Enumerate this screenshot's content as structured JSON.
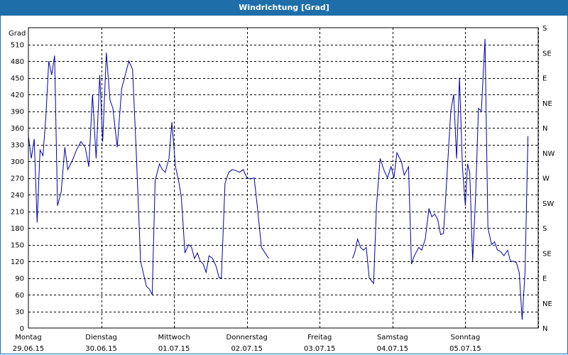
{
  "window": {
    "title": "Windrichtung [Grad]"
  },
  "chart_data": {
    "type": "line",
    "title": "Windrichtung [Grad]",
    "ylabel": "Grad",
    "ylim": [
      0,
      540
    ],
    "xlim": [
      0,
      7
    ],
    "y_ticks": [
      0,
      30,
      60,
      90,
      120,
      150,
      180,
      210,
      240,
      270,
      300,
      330,
      360,
      390,
      420,
      450,
      480,
      510
    ],
    "right_ticks": [
      {
        "v": 0,
        "label": "N"
      },
      {
        "v": 45,
        "label": "NE"
      },
      {
        "v": 90,
        "label": "E"
      },
      {
        "v": 135,
        "label": "SE"
      },
      {
        "v": 180,
        "label": "S"
      },
      {
        "v": 225,
        "label": "SW"
      },
      {
        "v": 270,
        "label": "W"
      },
      {
        "v": 315,
        "label": "NW"
      },
      {
        "v": 360,
        "label": "N"
      },
      {
        "v": 405,
        "label": "NE"
      },
      {
        "v": 450,
        "label": "E"
      },
      {
        "v": 495,
        "label": "SE"
      },
      {
        "v": 540,
        "label": "S"
      }
    ],
    "x_ticks": [
      {
        "day": "Montag",
        "date": "29.06.15"
      },
      {
        "day": "Dienstag",
        "date": "30.06.15"
      },
      {
        "day": "Mittwoch",
        "date": "01.07.15"
      },
      {
        "day": "Donnerstag",
        "date": "02.07.15"
      },
      {
        "day": "Freitag",
        "date": "03.07.15"
      },
      {
        "day": "Samstag",
        "date": "04.07.15"
      },
      {
        "day": "Sonntag",
        "date": "05.07.15"
      }
    ],
    "grid": true,
    "line_color": "#0000aa",
    "series": [
      {
        "segments": [
          [
            [
              0.0,
              345
            ],
            [
              0.04,
              305
            ],
            [
              0.08,
              340
            ],
            [
              0.12,
              190
            ],
            [
              0.16,
              320
            ],
            [
              0.2,
              310
            ],
            [
              0.24,
              380
            ],
            [
              0.28,
              480
            ],
            [
              0.32,
              455
            ],
            [
              0.36,
              490
            ],
            [
              0.4,
              220
            ],
            [
              0.45,
              245
            ],
            [
              0.5,
              325
            ],
            [
              0.54,
              285
            ],
            [
              0.6,
              300
            ],
            [
              0.66,
              320
            ],
            [
              0.72,
              335
            ],
            [
              0.78,
              325
            ],
            [
              0.83,
              290
            ],
            [
              0.88,
              420
            ],
            [
              0.93,
              305
            ],
            [
              0.98,
              455
            ],
            [
              1.02,
              335
            ],
            [
              1.07,
              495
            ],
            [
              1.12,
              410
            ],
            [
              1.16,
              395
            ],
            [
              1.22,
              325
            ],
            [
              1.28,
              430
            ],
            [
              1.34,
              460
            ],
            [
              1.38,
              480
            ],
            [
              1.43,
              465
            ],
            [
              1.48,
              320
            ],
            [
              1.54,
              120
            ],
            [
              1.62,
              75
            ],
            [
              1.66,
              70
            ],
            [
              1.7,
              60
            ],
            [
              1.74,
              265
            ],
            [
              1.8,
              295
            ],
            [
              1.84,
              285
            ],
            [
              1.88,
              280
            ],
            [
              1.93,
              305
            ],
            [
              1.97,
              370
            ],
            [
              2.02,
              290
            ],
            [
              2.07,
              260
            ],
            [
              2.1,
              235
            ],
            [
              2.15,
              135
            ],
            [
              2.2,
              150
            ],
            [
              2.24,
              145
            ],
            [
              2.28,
              125
            ],
            [
              2.32,
              135
            ],
            [
              2.36,
              120
            ],
            [
              2.4,
              115
            ],
            [
              2.44,
              100
            ],
            [
              2.48,
              130
            ],
            [
              2.53,
              125
            ],
            [
              2.58,
              110
            ],
            [
              2.62,
              90
            ],
            [
              2.65,
              90
            ],
            [
              2.7,
              260
            ],
            [
              2.75,
              280
            ],
            [
              2.8,
              285
            ],
            [
              2.85,
              283
            ],
            [
              2.9,
              280
            ],
            [
              2.95,
              285
            ],
            [
              3.0,
              270
            ],
            [
              3.05,
              268
            ],
            [
              3.1,
              270
            ],
            [
              3.15,
              210
            ],
            [
              3.2,
              145
            ],
            [
              3.25,
              135
            ],
            [
              3.3,
              125
            ]
          ],
          [
            [
              4.45,
              125
            ],
            [
              4.48,
              135
            ],
            [
              4.52,
              160
            ],
            [
              4.56,
              145
            ],
            [
              4.6,
              140
            ],
            [
              4.64,
              145
            ],
            [
              4.68,
              90
            ],
            [
              4.74,
              80
            ],
            [
              4.78,
              220
            ],
            [
              4.83,
              305
            ],
            [
              4.88,
              285
            ],
            [
              4.93,
              270
            ],
            [
              4.98,
              290
            ],
            [
              5.02,
              270
            ],
            [
              5.06,
              315
            ],
            [
              5.12,
              300
            ],
            [
              5.16,
              275
            ],
            [
              5.22,
              290
            ],
            [
              5.26,
              115
            ],
            [
              5.3,
              130
            ],
            [
              5.36,
              145
            ],
            [
              5.4,
              140
            ],
            [
              5.45,
              160
            ],
            [
              5.5,
              215
            ],
            [
              5.54,
              200
            ],
            [
              5.58,
              205
            ],
            [
              5.62,
              195
            ],
            [
              5.66,
              168
            ],
            [
              5.7,
              170
            ],
            [
              5.75,
              280
            ],
            [
              5.8,
              390
            ],
            [
              5.84,
              420
            ],
            [
              5.88,
              305
            ],
            [
              5.92,
              450
            ],
            [
              5.96,
              290
            ],
            [
              6.0,
              220
            ],
            [
              6.03,
              295
            ],
            [
              6.06,
              280
            ],
            [
              6.1,
              120
            ],
            [
              6.14,
              235
            ],
            [
              6.18,
              395
            ],
            [
              6.22,
              390
            ],
            [
              6.27,
              520
            ],
            [
              6.31,
              180
            ],
            [
              6.36,
              150
            ],
            [
              6.4,
              155
            ],
            [
              6.44,
              140
            ],
            [
              6.48,
              138
            ],
            [
              6.53,
              130
            ],
            [
              6.58,
              140
            ],
            [
              6.62,
              120
            ],
            [
              6.66,
              120
            ],
            [
              6.7,
              118
            ],
            [
              6.74,
              100
            ],
            [
              6.78,
              15
            ],
            [
              6.82,
              100
            ],
            [
              6.86,
              345
            ]
          ]
        ]
      }
    ]
  }
}
